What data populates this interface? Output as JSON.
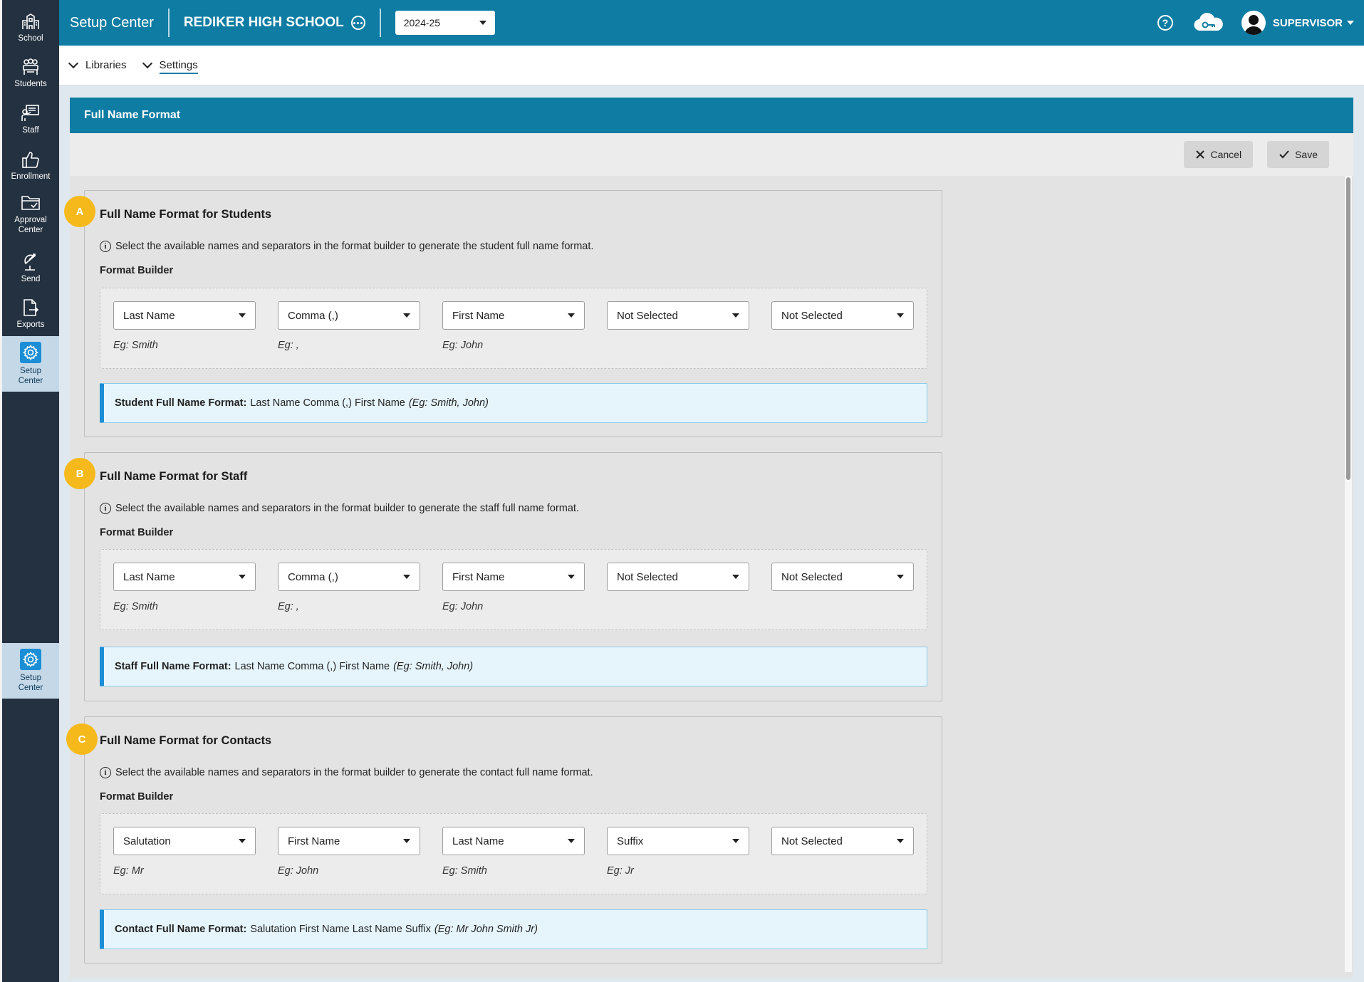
{
  "sidebar": {
    "items": [
      {
        "label": "School",
        "icon": "school-icon"
      },
      {
        "label": "Students",
        "icon": "students-icon"
      },
      {
        "label": "Staff",
        "icon": "staff-icon"
      },
      {
        "label": "Enrollment",
        "icon": "thumbs-up-icon"
      },
      {
        "label": "Approval\nCenter",
        "icon": "folder-check-icon"
      },
      {
        "label": "Send",
        "icon": "send-icon"
      },
      {
        "label": "Exports",
        "icon": "export-icon"
      },
      {
        "label": "Setup\nCenter",
        "icon": "gear-icon"
      }
    ],
    "bottom_item": {
      "label": "Setup\nCenter",
      "icon": "gear-icon"
    }
  },
  "header": {
    "app_title": "Setup Center",
    "school_name": "REDIKER HIGH SCHOOL",
    "year": "2024-25",
    "user": "SUPERVISOR"
  },
  "subnav": {
    "libraries": "Libraries",
    "settings": "Settings"
  },
  "panel": {
    "title": "Full Name Format",
    "cancel_label": "Cancel",
    "save_label": "Save"
  },
  "sections": [
    {
      "badge": "A",
      "title": "Full Name Format for Students",
      "info": "Select the available names and separators in the format builder to generate the student full name format.",
      "builder_label": "Format Builder",
      "slots": [
        {
          "value": "Last Name",
          "eg": "Eg: Smith"
        },
        {
          "value": "Comma (,)",
          "eg": "Eg: ,"
        },
        {
          "value": "First Name",
          "eg": "Eg: John"
        },
        {
          "value": "Not Selected",
          "eg": ""
        },
        {
          "value": "Not Selected",
          "eg": ""
        }
      ],
      "result_label": "Student Full Name Format:",
      "result_value": "Last Name Comma (,) First Name",
      "result_example": "(Eg: Smith, John)"
    },
    {
      "badge": "B",
      "title": "Full Name Format for Staff",
      "info": "Select the available names and separators in the format builder to generate the staff full name format.",
      "builder_label": "Format Builder",
      "slots": [
        {
          "value": "Last Name",
          "eg": "Eg: Smith"
        },
        {
          "value": "Comma (,)",
          "eg": "Eg: ,"
        },
        {
          "value": "First Name",
          "eg": "Eg: John"
        },
        {
          "value": "Not Selected",
          "eg": ""
        },
        {
          "value": "Not Selected",
          "eg": ""
        }
      ],
      "result_label": "Staff Full Name Format:",
      "result_value": "Last Name Comma (,) First Name",
      "result_example": "(Eg: Smith, John)"
    },
    {
      "badge": "C",
      "title": "Full Name Format for Contacts",
      "info": "Select the available names and separators in the format builder to generate the contact full name format.",
      "builder_label": "Format Builder",
      "slots": [
        {
          "value": "Salutation",
          "eg": "Eg: Mr"
        },
        {
          "value": "First Name",
          "eg": "Eg: John"
        },
        {
          "value": "Last Name",
          "eg": "Eg: Smith"
        },
        {
          "value": "Suffix",
          "eg": "Eg: Jr"
        },
        {
          "value": "Not Selected",
          "eg": ""
        }
      ],
      "result_label": "Contact Full Name Format:",
      "result_value": "Salutation First Name Last Name Suffix",
      "result_example": "(Eg: Mr John Smith Jr)"
    }
  ],
  "colors": {
    "brand": "#0e7ca3",
    "sidebar": "#243140",
    "badge": "#f6b91b",
    "result_accent": "#1b8ed6"
  }
}
